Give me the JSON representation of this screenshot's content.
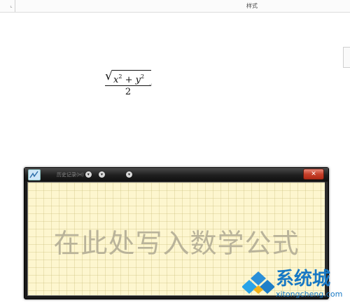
{
  "ribbon": {
    "expander_glyph": "⌞",
    "group_label": "样式"
  },
  "document": {
    "formula": {
      "radicand_x": "x",
      "exp_x": "2",
      "plus": " + ",
      "radicand_y": "y",
      "exp_y": "2",
      "denominator": "2"
    },
    "paragraph_mark": "↵"
  },
  "math_input_panel": {
    "menus": [
      {
        "label": "历史记录(H)",
        "icon": "chevron-down-icon"
      },
      {
        "label": "",
        "icon": "chevron-down-icon"
      },
      {
        "label": "",
        "icon": "chevron-down-icon"
      }
    ],
    "close_glyph": "✕",
    "canvas_placeholder": "在此处写入数学公式"
  },
  "watermark": {
    "text": "系统城",
    "url": "xitongcheng.com"
  },
  "colors": {
    "canvas_background": "#fdf6cf",
    "close_button": "#c7402a",
    "watermark_blue": "#1778c4"
  }
}
